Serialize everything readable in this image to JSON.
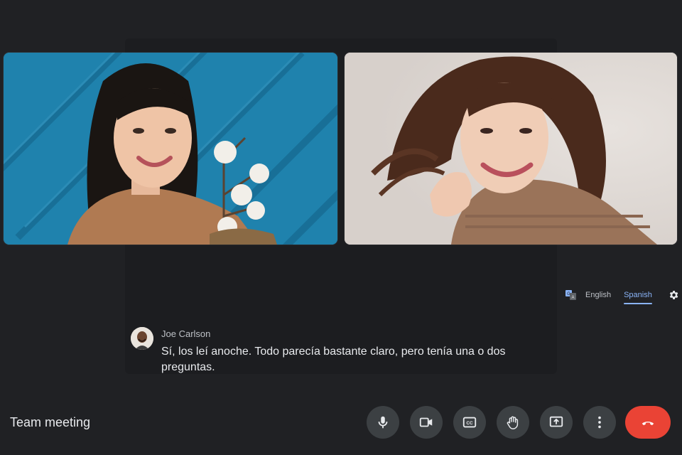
{
  "meeting": {
    "title": "Team meeting"
  },
  "participants": [
    {
      "name": "participant-left"
    },
    {
      "name": "participant-right"
    }
  ],
  "captions": {
    "languages": [
      {
        "label": "English",
        "active": false
      },
      {
        "label": "Spanish",
        "active": true
      }
    ],
    "speaker": "Joe Carlson",
    "text": "Sí, los leí anoche. Todo parecía bastante claro, pero tenía una o dos preguntas."
  },
  "controls": [
    {
      "icon": "microphone-icon"
    },
    {
      "icon": "camera-icon"
    },
    {
      "icon": "closed-captions-icon"
    },
    {
      "icon": "raise-hand-icon"
    },
    {
      "icon": "present-screen-icon"
    },
    {
      "icon": "more-options-icon"
    },
    {
      "icon": "end-call-icon"
    }
  ],
  "colors": {
    "background": "#202124",
    "control_button": "#3c4043",
    "end_call": "#ea4335",
    "active_language": "#8ab4f8"
  }
}
